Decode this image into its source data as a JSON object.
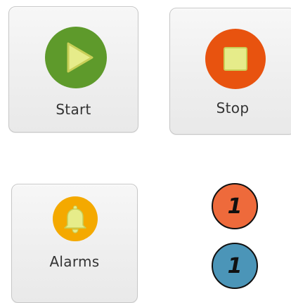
{
  "controls": {
    "start": {
      "label": "Start",
      "icon": "play-icon",
      "color": "#5e9a2b"
    },
    "stop": {
      "label": "Stop",
      "icon": "stop-icon",
      "color": "#e8530f"
    },
    "alarms": {
      "label": "Alarms",
      "icon": "bell-icon",
      "color": "#f4a900"
    }
  },
  "badges": [
    {
      "value": "1",
      "color": "#ee6a3b"
    },
    {
      "value": "1",
      "color": "#4b95b8"
    }
  ]
}
